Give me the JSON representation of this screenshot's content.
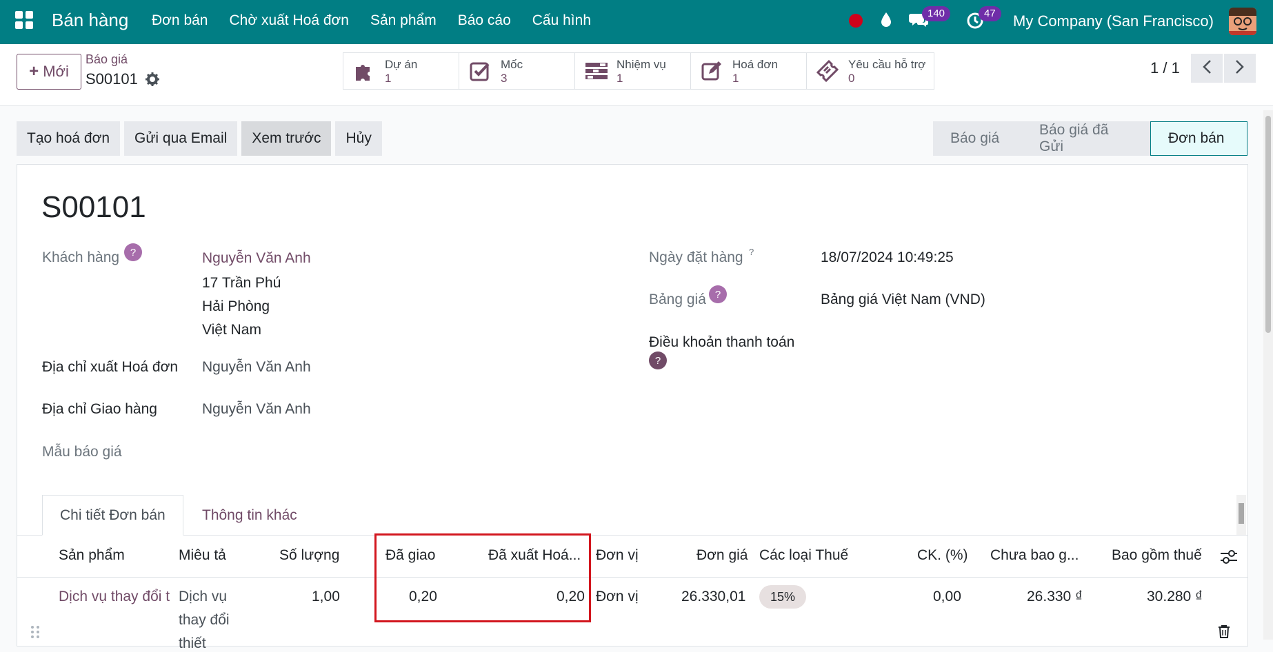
{
  "navbar": {
    "brand": "Bán hàng",
    "menu": [
      "Đơn bán",
      "Chờ xuất Hoá đơn",
      "Sản phẩm",
      "Báo cáo",
      "Cấu hình"
    ],
    "messages_count": "140",
    "activities_count": "47",
    "company": "My Company (San Francisco)"
  },
  "control": {
    "new_label": "Mới",
    "breadcrumb_parent": "Báo giá",
    "breadcrumb_current": "S00101",
    "smart_buttons": [
      {
        "label": "Dự án",
        "value": "1",
        "icon": "puzzle-icon"
      },
      {
        "label": "Mốc",
        "value": "3",
        "icon": "check-square-icon"
      },
      {
        "label": "Nhiệm vụ",
        "value": "1",
        "icon": "tasks-icon"
      },
      {
        "label": "Hoá đơn",
        "value": "1",
        "icon": "edit-icon"
      },
      {
        "label": "Yêu cầu hỗ trợ",
        "value": "0",
        "icon": "ticket-icon"
      }
    ],
    "pager": "1 / 1"
  },
  "actions": [
    "Tạo hoá đơn",
    "Gửi qua Email",
    "Xem trước",
    "Hủy"
  ],
  "statusbar": [
    "Báo giá",
    "Báo giá đã Gửi",
    "Đơn bán"
  ],
  "form": {
    "title": "S00101",
    "customer_label": "Khách hàng",
    "customer_name": "Nguyễn Văn Anh",
    "address_lines": [
      "17 Trần Phú",
      "Hải Phòng",
      "Việt Nam"
    ],
    "invoice_address_label": "Địa chỉ xuất Hoá đơn",
    "invoice_address": "Nguyễn Văn Anh",
    "delivery_address_label": "Địa chỉ Giao hàng",
    "delivery_address": "Nguyễn Văn Anh",
    "template_label": "Mẫu báo giá",
    "order_date_label": "Ngày đặt hàng",
    "order_date": "18/07/2024 10:49:25",
    "pricelist_label": "Bảng giá",
    "pricelist": "Bảng giá Việt Nam (VND)",
    "payment_terms_label": "Điều khoản thanh toán",
    "help_mark": "?"
  },
  "tabs": [
    "Chi tiết Đơn bán",
    "Thông tin khác"
  ],
  "table": {
    "headers": [
      "Sản phẩm",
      "Miêu tả",
      "Số lượng",
      "Đã giao",
      "Đã xuất Hoá...",
      "Đơn vị",
      "Đơn giá",
      "Các loại Thuế",
      "CK. (%)",
      "Chưa bao g...",
      "Bao gồm thuế"
    ],
    "row": {
      "product": "Dịch vụ thay đổi t",
      "description_lines": [
        "Dịch vụ",
        "thay đổi",
        "thiết"
      ],
      "quantity": "1,00",
      "delivered": "0,20",
      "invoiced": "0,20",
      "uom": "Đơn vị",
      "unit_price": "26.330,01",
      "tax": "15%",
      "discount": "0,00",
      "subtotal": "26.330 ₫",
      "total": "30.280 ₫"
    }
  },
  "colors": {
    "navbar": "#017e84",
    "accent": "#714b67",
    "highlight": "#d2161e"
  }
}
